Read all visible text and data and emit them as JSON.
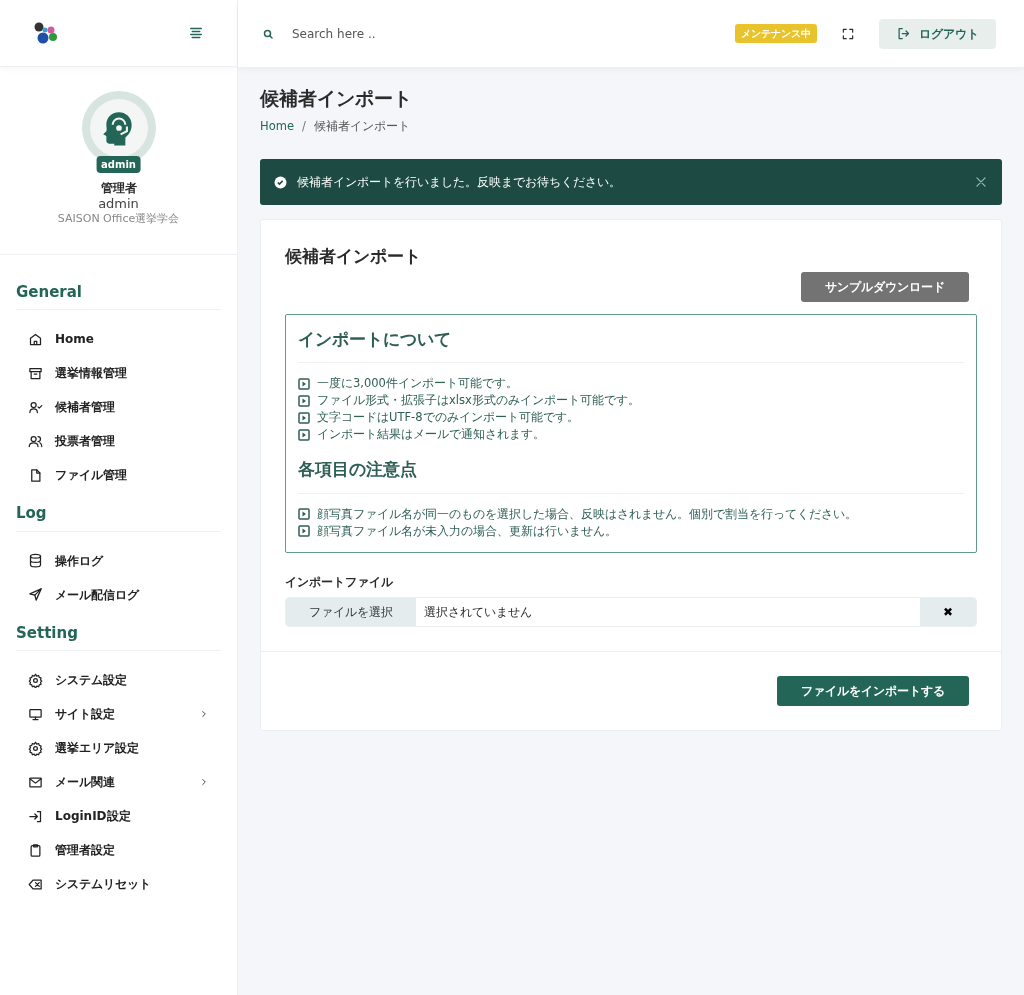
{
  "profile": {
    "badge": "admin",
    "name": "管理者",
    "username": "admin",
    "organization": "SAISON Office選挙学会"
  },
  "sidebar": {
    "sections": [
      {
        "title": "General",
        "items": [
          {
            "label": "Home",
            "has_submenu": false
          },
          {
            "label": "選挙情報管理",
            "has_submenu": false
          },
          {
            "label": "候補者管理",
            "has_submenu": false
          },
          {
            "label": "投票者管理",
            "has_submenu": false
          },
          {
            "label": "ファイル管理",
            "has_submenu": false
          }
        ]
      },
      {
        "title": "Log",
        "items": [
          {
            "label": "操作ログ",
            "has_submenu": false
          },
          {
            "label": "メール配信ログ",
            "has_submenu": false
          }
        ]
      },
      {
        "title": "Setting",
        "items": [
          {
            "label": "システム設定",
            "has_submenu": false
          },
          {
            "label": "サイト設定",
            "has_submenu": true
          },
          {
            "label": "選挙エリア設定",
            "has_submenu": false
          },
          {
            "label": "メール関連",
            "has_submenu": true
          },
          {
            "label": "LoginID設定",
            "has_submenu": false
          },
          {
            "label": "管理者設定",
            "has_submenu": false
          },
          {
            "label": "システムリセット",
            "has_submenu": false
          }
        ]
      }
    ]
  },
  "topbar": {
    "search_placeholder": "Search here ..",
    "status_badge": "メンテナンス中",
    "logout": "ログアウト"
  },
  "page": {
    "title": "候補者インポート",
    "breadcrumb": [
      "Home",
      "候補者インポート"
    ],
    "breadcrumb_separator": "/"
  },
  "alert": {
    "message": "候補者インポートを行いました。反映までお待ちください。"
  },
  "card": {
    "title": "候補者インポート",
    "sample_button": "サンプルダウンロード",
    "info_sections": [
      {
        "heading": "インポートについて",
        "items": [
          "一度に3,000件インポート可能です。",
          "ファイル形式・拡張子はxlsx形式のみインポート可能です。",
          "文字コードはUTF-8でのみインポート可能です。",
          "インポート結果はメールで通知されます。"
        ]
      },
      {
        "heading": "各項目の注意点",
        "items": [
          "顔写真ファイル名が同一のものを選択した場合、反映はされません。個別で割当を行ってください。",
          "顔写真ファイル名が未入力の場合、更新は行いません。"
        ]
      }
    ],
    "file_label": "インポートファイル",
    "file_button": "ファイルを選択",
    "file_status": "選択されていません",
    "clear_button": "✖",
    "submit": "ファイルをインポートする"
  }
}
